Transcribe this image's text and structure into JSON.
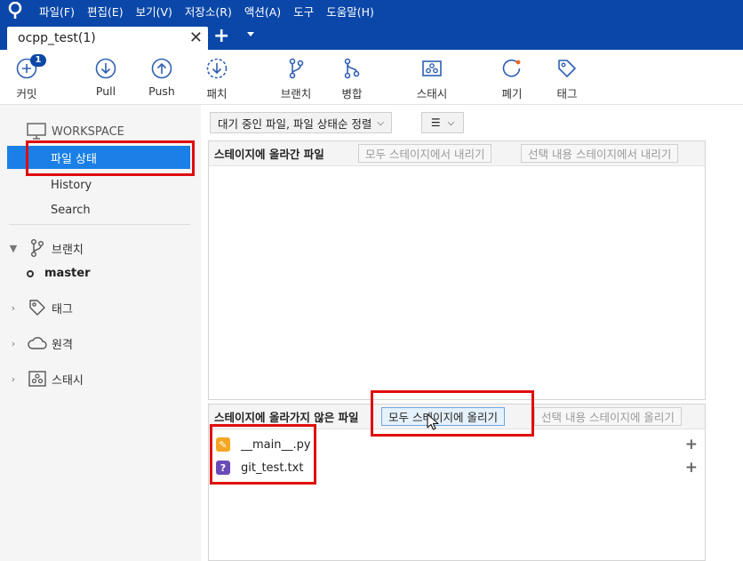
{
  "menubar": {
    "items": [
      "파일(F)",
      "편집(E)",
      "보기(V)",
      "저장소(R)",
      "액션(A)",
      "도구",
      "도움말(H)"
    ]
  },
  "tabs": {
    "active_title": "ocpp_test(1)",
    "close_glyph": "✕",
    "add_glyph": "+"
  },
  "toolbar": {
    "commit": "커밋",
    "commit_badge": "1",
    "pull": "Pull",
    "push": "Push",
    "fetch": "패치",
    "branch": "브랜치",
    "merge": "병합",
    "stash": "스태시",
    "discard": "폐기",
    "tag": "태그"
  },
  "sidebar": {
    "workspace_label": "WORKSPACE",
    "items": [
      "파일 상태",
      "History",
      "Search"
    ],
    "selected_index": 0,
    "branches_label": "브랜치",
    "current_branch": "master",
    "tags_label": "태그",
    "remotes_label": "원격",
    "stashes_label": "스태시"
  },
  "main": {
    "sort_dropdown": "대기 중인 파일, 파일 상태순 정렬",
    "view_dropdown_icon": "☰",
    "staged": {
      "title": "스테이지에 올라간 파일",
      "unstage_all": "모두 스테이지에서 내리기",
      "unstage_selected": "선택 내용 스테이지에서 내리기"
    },
    "unstaged": {
      "title": "스테이지에 올라가지 않은 파일",
      "stage_all": "모두 스테이지에 올리기",
      "stage_selected": "선택 내용 스테이지에 올리기",
      "files": [
        {
          "name": "__main__.py",
          "status_icon": "modified-icon",
          "icon_glyph": "✎"
        },
        {
          "name": "git_test.txt",
          "status_icon": "untracked-icon",
          "icon_glyph": "?"
        }
      ]
    }
  },
  "colors": {
    "brand_blue": "#0a47a8",
    "selection_blue": "#1a7fe6",
    "highlight_red": "#e00d0d",
    "modified_orange": "#f5a623",
    "untracked_purple": "#6b4bb8"
  }
}
